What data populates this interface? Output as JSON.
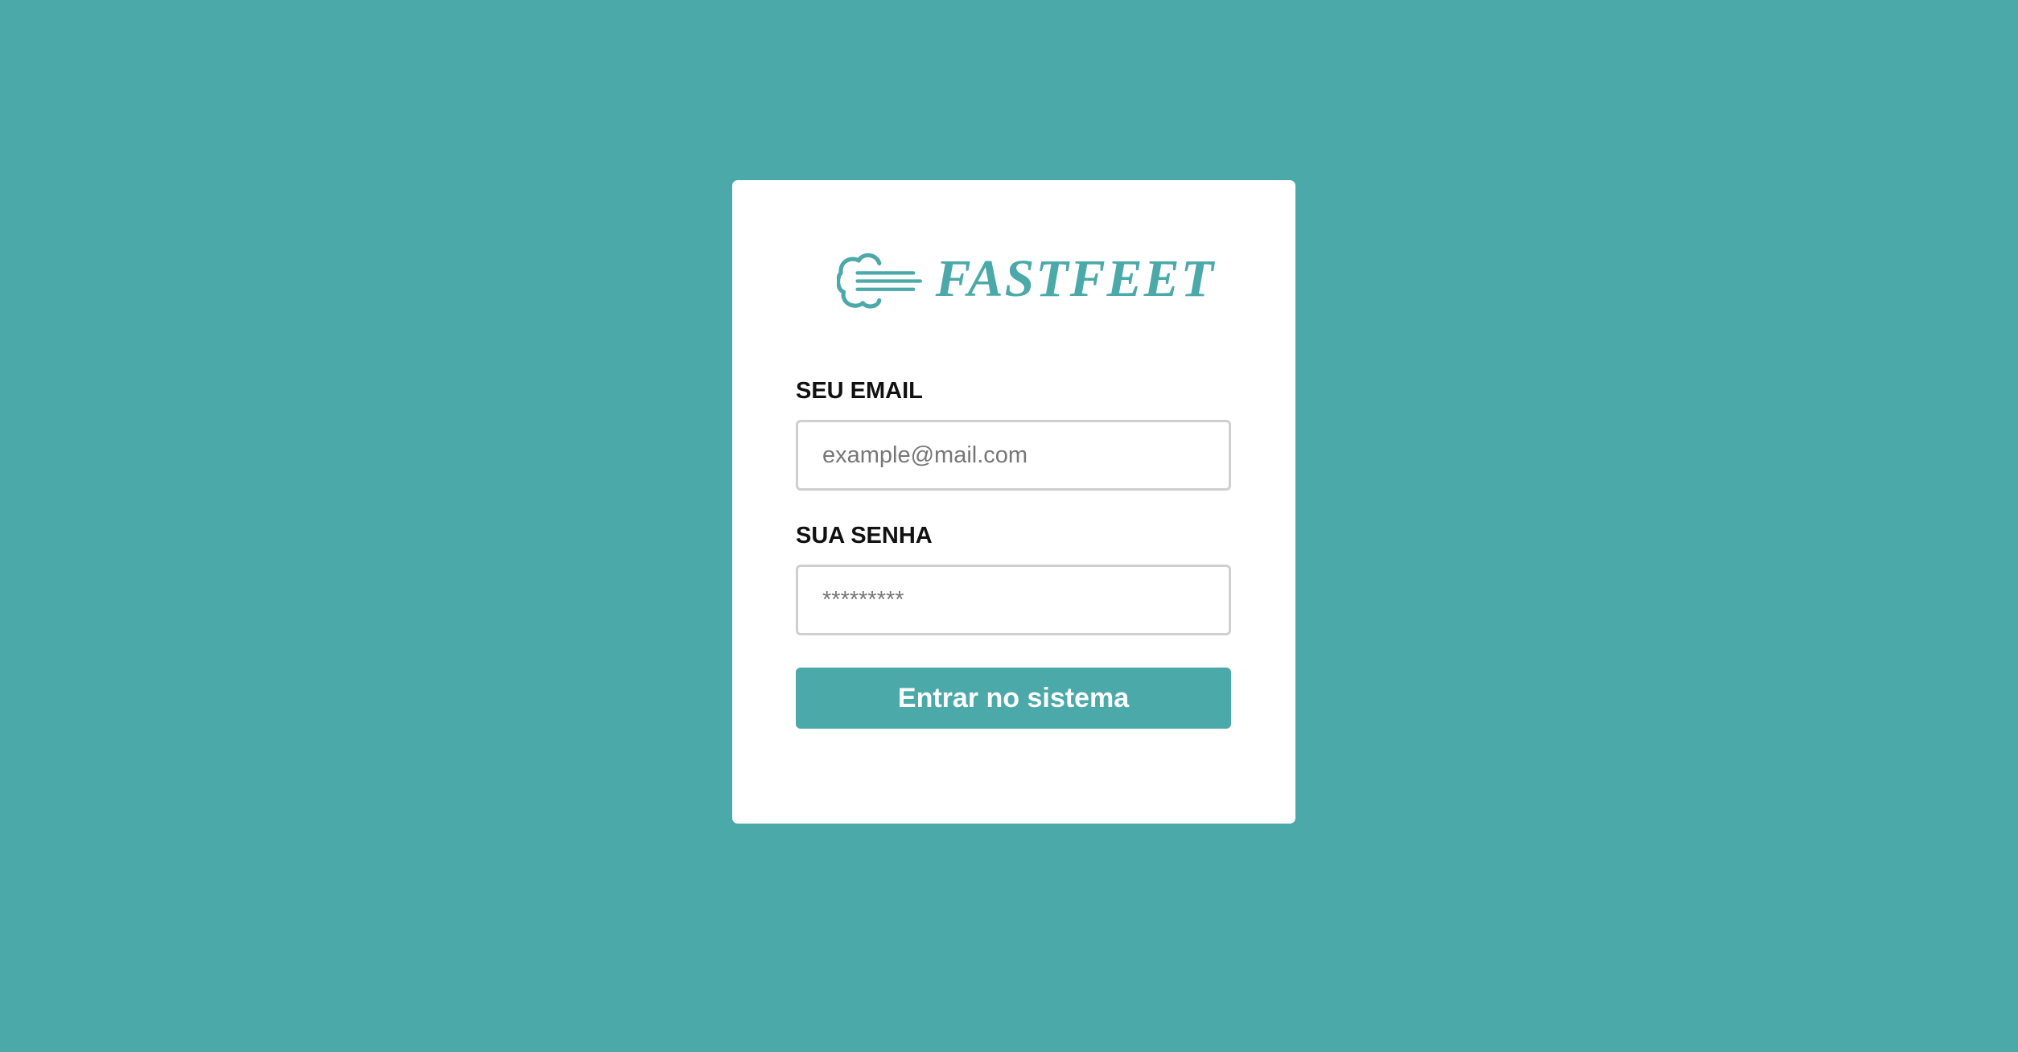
{
  "theme": {
    "background": "#4ba9a9",
    "accent": "#4ba9a9",
    "card": "#ffffff"
  },
  "logo": {
    "icon": "fast-wind-icon",
    "text": "FASTFEET"
  },
  "form": {
    "email_label": "SEU EMAIL",
    "email_placeholder": "example@mail.com",
    "password_label": "SUA SENHA",
    "password_placeholder": "*********",
    "submit_label": "Entrar no sistema"
  }
}
